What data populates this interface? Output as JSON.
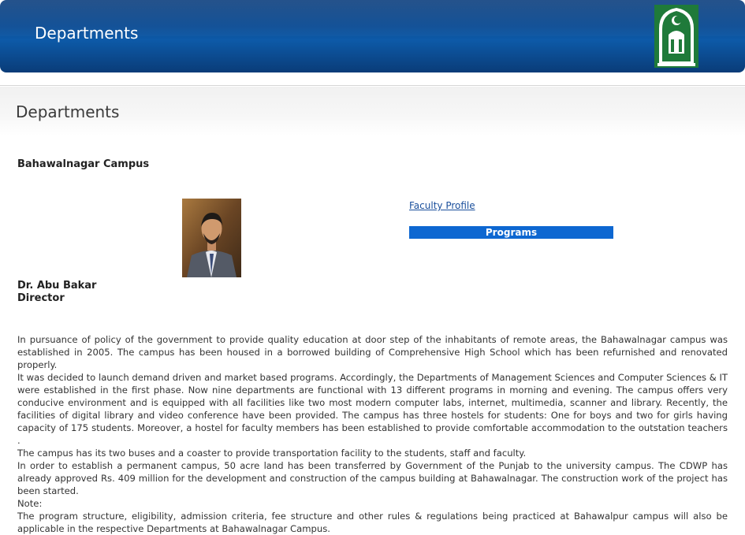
{
  "banner": {
    "title": "Departments",
    "logo_icon": "university-logo-icon",
    "colors": {
      "primary": "#0a4a92",
      "accent": "#1f7a3a"
    }
  },
  "page": {
    "title": "Departments",
    "campus": "Bahawalnagar Campus"
  },
  "director": {
    "photo_icon": "director-photo",
    "name": "Dr. Abu Bakar",
    "role": "Director"
  },
  "links": {
    "faculty_profile": "Faculty Profile",
    "programs": "Programs",
    "programs_color": "#0d67d1"
  },
  "content": {
    "paragraphs": [
      "In pursuance of policy of the government to provide quality education at door step of the inhabitants of remote areas, the Bahawalnagar campus was established in 2005. The campus has been housed in a borrowed building of Comprehensive High School which has been refurnished and renovated properly.",
      "It was decided to launch demand driven and market based programs. Accordingly, the Departments of Management Sciences and Computer Sciences & IT were established in the first phase. Now nine departments are functional with 13 different programs in morning and evening. The campus offers very conducive environment and is equipped with all facilities like two most modern computer labs, internet, multimedia, scanner and library. Recently, the facilities of digital library and video conference have been provided. The campus has three hostels for students: One for boys and two for girls having capacity of 175 students. Moreover, a hostel for faculty members has been established to provide comfortable accommodation to the outstation teachers .",
      "The campus has its two buses and a coaster to provide transportation facility to the students, staff and faculty.",
      "In order to establish a permanent campus, 50 acre land has been transferred by Government of the Punjab to the university campus. The CDWP has already approved Rs. 409 million for the development and construction of the campus building at Bahawalnagar. The construction work of the project has been started.",
      "Note:",
      "The program structure, eligibility, admission criteria, fee structure and other rules & regulations being practiced at Bahawalpur campus will also be applicable in the respective Departments at Bahawalnagar Campus."
    ]
  }
}
